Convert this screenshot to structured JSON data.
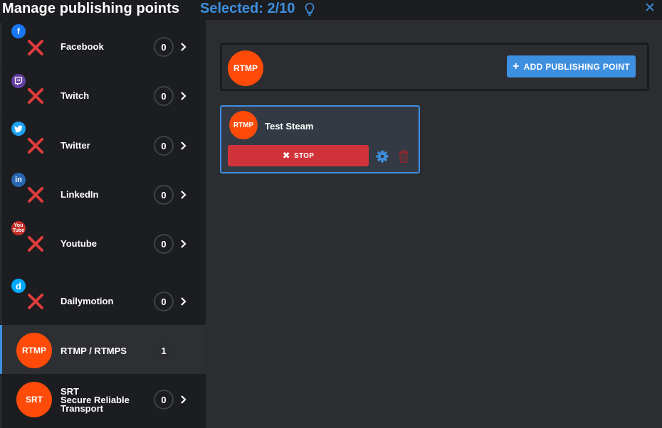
{
  "header": {
    "title": "Manage publishing points",
    "selected": "Selected: 2/10",
    "bulb_icon": "lightbulb-icon",
    "close_icon": "close-icon"
  },
  "sidebar": {
    "items": [
      {
        "label": "Facebook",
        "count": "0",
        "icon": "facebook-icon",
        "color": "#1877f2",
        "status": "not-connected"
      },
      {
        "label": "Twitch",
        "count": "0",
        "icon": "twitch-icon",
        "color": "#6441a5",
        "status": "not-connected"
      },
      {
        "label": "Twitter",
        "count": "0",
        "icon": "twitter-icon",
        "color": "#1da1f2",
        "status": "not-connected"
      },
      {
        "label": "LinkedIn",
        "count": "0",
        "icon": "linkedin-icon",
        "color": "#2867b2",
        "status": "not-connected"
      },
      {
        "label": "Youtube",
        "count": "0",
        "icon": "youtube-icon",
        "color": "#c4302b",
        "status": "not-connected"
      },
      {
        "label": "Dailymotion",
        "count": "0",
        "icon": "dailymotion-icon",
        "color": "#00aaff",
        "status": "not-connected"
      },
      {
        "label": "RTMP / RTMPS",
        "count": "1",
        "badge": "RTMP",
        "active": true
      },
      {
        "label_lines": [
          "SRT",
          "Secure Reliable",
          "Transport"
        ],
        "count": "0",
        "badge": "SRT"
      }
    ]
  },
  "main": {
    "protocol_badge": "RTMP",
    "add_button": "ADD PUBLISHING POINT",
    "card": {
      "badge": "RTMP",
      "name": "Test Steam",
      "stop_label": "STOP"
    }
  },
  "colors": {
    "accent": "#3d8fe0",
    "rtmp_orange": "#fe4b0a",
    "stop_red": "#d0343a",
    "error_red": "#e03c3c"
  }
}
